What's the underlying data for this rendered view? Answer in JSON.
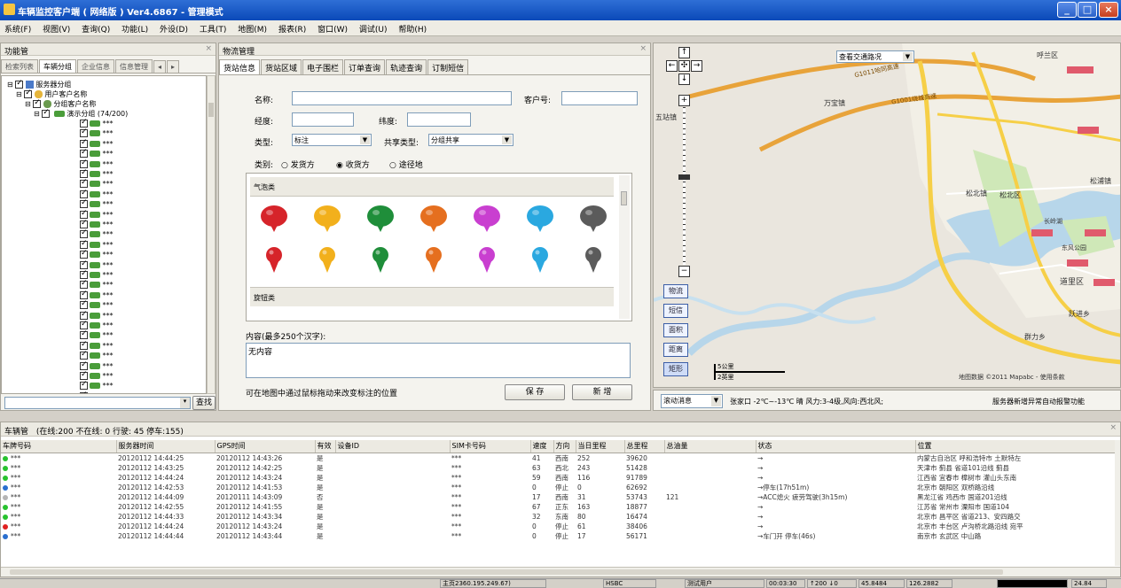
{
  "window": {
    "title": "车辆监控客户端 ( 网络版 ) Ver4.6867 - 管理模式"
  },
  "menu": [
    "系统(F)",
    "视图(V)",
    "查询(Q)",
    "功能(L)",
    "外设(D)",
    "工具(T)",
    "地图(M)",
    "报表(R)",
    "窗口(W)",
    "调试(U)",
    "帮助(H)"
  ],
  "left_panel": {
    "title": "功能管",
    "tabs": [
      "检索列表",
      "车辆分组",
      "企业信息",
      "信息管理"
    ],
    "tree": {
      "root": "服务器分组",
      "user": "用户客户名称",
      "group": "分组客户名称",
      "demo": "演示分组 (74/200)",
      "vehicle_label": "***"
    },
    "search_button": "查找"
  },
  "logistics": {
    "title": "物流管理",
    "tabs": [
      "货站信息",
      "货站区域",
      "电子围栏",
      "订单查询",
      "轨迹查询",
      "订制短信"
    ],
    "name_label": "名称:",
    "customer_no_label": "客户号:",
    "longitude_label": "经度:",
    "latitude_label": "纬度:",
    "type_label": "类型:",
    "type_value": "标注",
    "share_type_label": "共享类型:",
    "share_type_value": "分组共享",
    "category_label": "类别:",
    "category_options": [
      "发货方",
      "收货方",
      "途径地"
    ],
    "category_selected": "收货方",
    "balloon_header": "气泡类",
    "rotate_header": "旋钮类",
    "content_label": "内容(最多250个汉字):",
    "content_value": "无内容",
    "hint": "可在地图中通过鼠标拖动来改变标注的位置",
    "save_button": "保 存",
    "new_button": "新 增"
  },
  "map": {
    "traffic_select": "查看交通路况",
    "places": [
      "呼兰区",
      "万宝镇",
      "松北镇",
      "松北区",
      "道里区",
      "群力乡",
      "五站镇",
      "长岭湖",
      "东风公园",
      "跃进乡",
      "松浦镇"
    ],
    "roads": [
      "G1011哈同高速",
      "G1001绕城高速"
    ],
    "side_buttons": [
      "物流",
      "短信",
      "面积",
      "距离",
      "矩形"
    ],
    "scale_km": "5公里",
    "scale_mi": "2英里",
    "copyright": "地图数据 ©2011 Mapabc - 使用条款",
    "scroll_select": "滚动消息",
    "weather": "张家口 -2℃~-13℃ 晴 风力:3-4级,风向:西北风;",
    "notice": "服务器新增异常自动报警功能"
  },
  "vehicles": {
    "title": "车辆管",
    "summary": "(在线:200 不在线: 0 行驶: 45 停车:155)",
    "columns": [
      "车牌号码",
      "服务器时间",
      "GPS时间",
      "有效",
      "设备ID",
      "SIM卡号码",
      "速度",
      "方向",
      "当日里程",
      "总里程",
      "总油量",
      "状态",
      "位置"
    ],
    "rows": [
      {
        "status": "green",
        "plate": "***",
        "server_time": "20120112 14:44:25",
        "gps_time": "20120112 14:43:26",
        "valid": "是",
        "device": "",
        "sim": "***",
        "speed": "41",
        "dir": "西南",
        "day_km": "252",
        "total_km": "39620",
        "fuel": "",
        "state": "→",
        "location": "内蒙古自治区 呼和浩特市 土默特左"
      },
      {
        "status": "green",
        "plate": "***",
        "server_time": "20120112 14:43:25",
        "gps_time": "20120112 14:42:25",
        "valid": "是",
        "device": "",
        "sim": "***",
        "speed": "63",
        "dir": "西北",
        "day_km": "243",
        "total_km": "51428",
        "fuel": "",
        "state": "→",
        "location": "天津市 蓟县 省道101沿线 蓟县"
      },
      {
        "status": "green",
        "plate": "***",
        "server_time": "20120112 14:44:24",
        "gps_time": "20120112 14:43:24",
        "valid": "是",
        "device": "",
        "sim": "***",
        "speed": "59",
        "dir": "西南",
        "day_km": "116",
        "total_km": "91789",
        "fuel": "",
        "state": "→",
        "location": "江西省 宜春市 樟树市 灌山头东南"
      },
      {
        "status": "blue",
        "plate": "***",
        "server_time": "20120112 14:42:53",
        "gps_time": "20120112 14:41:53",
        "valid": "是",
        "device": "",
        "sim": "***",
        "speed": "0",
        "dir": "停止",
        "day_km": "0",
        "total_km": "62692",
        "fuel": "",
        "state": "→停车(17h51m)",
        "location": "北京市 朝阳区 双桥路沿线"
      },
      {
        "status": "gray",
        "plate": "***",
        "server_time": "20120112 14:44:09",
        "gps_time": "20120111 14:43:09",
        "valid": "否",
        "device": "",
        "sim": "***",
        "speed": "17",
        "dir": "西南",
        "day_km": "31",
        "total_km": "53743",
        "fuel": "121",
        "state": "→ACC熄火 疲劳驾驶(3h15m)",
        "location": "黑龙江省 鸡西市 国道201沿线"
      },
      {
        "status": "green",
        "plate": "***",
        "server_time": "20120112 14:42:55",
        "gps_time": "20120112 14:41:55",
        "valid": "是",
        "device": "",
        "sim": "***",
        "speed": "67",
        "dir": "正东",
        "day_km": "163",
        "total_km": "18877",
        "fuel": "",
        "state": "→",
        "location": "江苏省 常州市 溧阳市 国道104"
      },
      {
        "status": "green",
        "plate": "***",
        "server_time": "20120112 14:44:33",
        "gps_time": "20120112 14:43:34",
        "valid": "是",
        "device": "",
        "sim": "***",
        "speed": "32",
        "dir": "东南",
        "day_km": "80",
        "total_km": "16474",
        "fuel": "",
        "state": "→",
        "location": "北京市 昌平区 省道213、安四路交"
      },
      {
        "status": "red",
        "plate": "***",
        "server_time": "20120112 14:44:24",
        "gps_time": "20120112 14:43:24",
        "valid": "是",
        "device": "",
        "sim": "***",
        "speed": "0",
        "dir": "停止",
        "day_km": "61",
        "total_km": "38406",
        "fuel": "",
        "state": "→",
        "location": "北京市 丰台区 卢沟桥北路沿线 宛平"
      },
      {
        "status": "blue",
        "plate": "***",
        "server_time": "20120112 14:44:44",
        "gps_time": "20120112 14:43:44",
        "valid": "是",
        "device": "",
        "sim": "***",
        "speed": "0",
        "dir": "停止",
        "day_km": "17",
        "total_km": "56171",
        "fuel": "",
        "state": "→车门开 停车(46s)",
        "location": "南京市 玄武区 中山路"
      }
    ]
  },
  "statusbar": [
    "主页2360.195.249.67)",
    "HSBC",
    "测试用户",
    "00:03:30",
    "↑200 ↓0",
    "45.8484",
    "126.2882",
    "",
    "24.84"
  ],
  "colors": {
    "title_bar": "#0a49b8",
    "map_land": "#eae6de",
    "map_water": "#b7d6ea",
    "map_green": "#cfe8b8",
    "road_yellow": "#f6cf47",
    "road_orange": "#e8a33a",
    "place_label_bg": "#e05a6c"
  }
}
